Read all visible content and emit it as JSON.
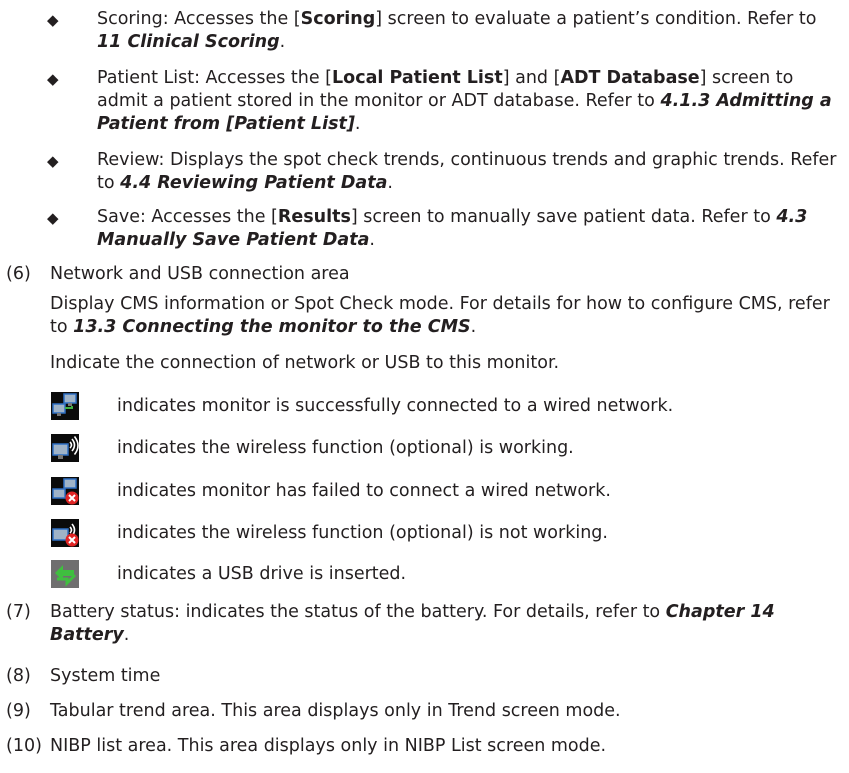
{
  "bullets": [
    {
      "pre": "Scoring: Accesses the [",
      "b1": "Scoring",
      "mid": "] screen to evaluate a patient’s condition. Refer to ",
      "ref": "11 Clinical Scoring",
      "post": "."
    },
    {
      "pre": "Patient List: Accesses the [",
      "b1": "Local Patient List",
      "mid1": "] and [",
      "b2": "ADT Database",
      "mid2": "] screen to admit a patient stored in the monitor or ADT database. Refer to ",
      "ref": "4.1.3 Admitting a Patient from [Patient List]",
      "post": "."
    },
    {
      "pre": "Review: Displays the spot check trends, continuous trends and graphic trends. Refer to ",
      "ref": "4.4 Reviewing Patient Data",
      "post": "."
    },
    {
      "pre": "Save: Accesses the [",
      "b1": "Results",
      "mid": "] screen to manually save patient data. Refer to ",
      "ref": "4.3 Manually Save Patient Data",
      "post": "."
    }
  ],
  "section6": {
    "number": "(6)",
    "title": "Network and USB connection area",
    "para1_pre": "Display CMS information or Spot Check mode. For details for how to configure CMS, refer to ",
    "para1_ref": "13.3 Connecting the monitor to the CMS",
    "para1_post": ".",
    "para2": "Indicate the connection of network or USB to this monitor.",
    "icons": [
      {
        "icon": "wired-network-connected-icon",
        "text": "indicates monitor is successfully connected to a wired network."
      },
      {
        "icon": "wireless-working-icon",
        "text": "indicates the wireless function (optional) is working."
      },
      {
        "icon": "wired-network-failed-icon",
        "text": "indicates monitor has failed to connect a wired network."
      },
      {
        "icon": "wireless-not-working-icon",
        "text": "indicates the wireless function (optional) is not working."
      },
      {
        "icon": "usb-inserted-icon",
        "text": "indicates a USB drive is inserted."
      }
    ]
  },
  "section7": {
    "number": "(7)",
    "pre": "Battery status: indicates the status of the battery. For details, refer to ",
    "ref": "Chapter 14 Battery",
    "post": "."
  },
  "section8": {
    "number": "(8)",
    "text": "System time"
  },
  "section9": {
    "number": "(9)",
    "text": "Tabular trend area. This area displays only in Trend screen mode."
  },
  "section10": {
    "number": "(10)",
    "text": "NIBP list area. This area displays only in NIBP List screen mode."
  }
}
